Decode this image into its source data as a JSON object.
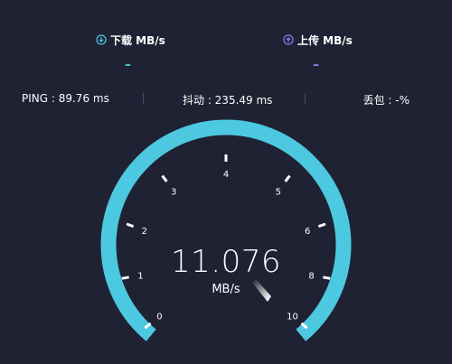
{
  "download": {
    "label": "下载 MB/s",
    "value": "–",
    "icon": "download-icon",
    "color": "#4cc9e0"
  },
  "upload": {
    "label": "上传 MB/s",
    "value": "–",
    "icon": "upload-icon",
    "color": "#8b7cf0"
  },
  "metrics": {
    "ping": "PING : 89.76 ms",
    "jitter": "抖动 : 235.49 ms",
    "loss": "丢包 : -%"
  },
  "gauge": {
    "value": "11.076",
    "unit": "MB/s",
    "ticks": [
      "0",
      "1",
      "2",
      "3",
      "4",
      "5",
      "6",
      "8",
      "10"
    ],
    "reading": 11.076,
    "scale_max": 10,
    "arc_color": "#4cc9e0",
    "background": "#1f2233"
  }
}
